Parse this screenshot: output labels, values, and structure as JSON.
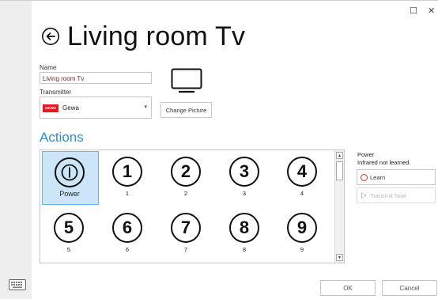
{
  "window": {
    "maximize_glyph": "☐",
    "close_glyph": "✕"
  },
  "page": {
    "title": "Living room Tv",
    "back_icon": "circle-arrow-left-icon"
  },
  "form": {
    "name_label": "Name",
    "name_value": "Living room Tv",
    "transmitter_label": "Transmitter",
    "transmitter_value": "Gewa",
    "transmitter_logo_text": "GEWA",
    "picture_icon": "tv-icon",
    "change_picture_label": "Change Picture"
  },
  "actions": {
    "title": "Actions",
    "items": [
      {
        "symbol": "power-icon",
        "label": "Power",
        "selected": true
      },
      {
        "symbol": "1",
        "label": "1"
      },
      {
        "symbol": "2",
        "label": "2"
      },
      {
        "symbol": "3",
        "label": "3"
      },
      {
        "symbol": "4",
        "label": "4"
      },
      {
        "symbol": "5",
        "label": "5"
      },
      {
        "symbol": "6",
        "label": "6"
      },
      {
        "symbol": "7",
        "label": "7"
      },
      {
        "symbol": "8",
        "label": "8"
      },
      {
        "symbol": "9",
        "label": "9"
      }
    ],
    "scroll_up_glyph": "▲",
    "scroll_down_glyph": "▼"
  },
  "side_panel": {
    "title": "Power",
    "status": "Infrared not learned.",
    "learn_label": "Learn",
    "transmit_label": "Transmit Now"
  },
  "footer": {
    "ok_label": "OK",
    "cancel_label": "Cancel",
    "keyboard_icon": "keyboard-icon"
  },
  "colors": {
    "accent": "#2d8fd3",
    "selection": "#cce6f7",
    "learn_icon": "#dd3333",
    "brand_red": "#e21b23"
  }
}
